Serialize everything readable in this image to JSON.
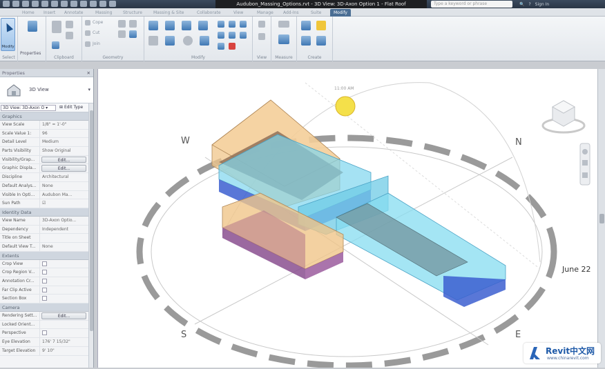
{
  "titlebar": {
    "document_title": "Audubon_Massing_Options.rvt - 3D View: 3D-Axon Option 1 - Flat Roof",
    "search_placeholder": "Type a keyword or phrase",
    "signin": "Sign In",
    "help": "?"
  },
  "tabs": [
    {
      "label": "Home"
    },
    {
      "label": "Insert"
    },
    {
      "label": "Annotate"
    },
    {
      "label": "Massing"
    },
    {
      "label": "Structure"
    },
    {
      "label": "Massing & Site"
    },
    {
      "label": "Collaborate"
    },
    {
      "label": "View"
    },
    {
      "label": "Manage"
    },
    {
      "label": "Add-Ins"
    },
    {
      "label": "Suite"
    },
    {
      "label": "Modify"
    }
  ],
  "ribbon": {
    "select_panel": "Select",
    "modify_button": "Modify",
    "properties_panel": "Properties",
    "clipboard_panel": "Clipboard",
    "geometry_panel": "Geometry",
    "modify_panel": "Modify",
    "view_panel": "View",
    "measure_panel": "Measure",
    "create_panel": "Create",
    "cope_label": "Cope",
    "cut_label": "Cut",
    "join_label": "Join"
  },
  "properties": {
    "header": "Properties",
    "close": "✕",
    "type_name": "3D View",
    "type_filter": "3D View: 3D-Axon O ▾",
    "edit_type": "Edit Type",
    "groups": [
      {
        "name": "Graphics",
        "rows": [
          {
            "key": "View Scale",
            "value": "1/8\" = 1'-0\"",
            "kind": "field"
          },
          {
            "key": "Scale Value    1:",
            "value": "96",
            "kind": "text"
          },
          {
            "key": "Detail Level",
            "value": "Medium",
            "kind": "text"
          },
          {
            "key": "Parts Visibility",
            "value": "Show Original",
            "kind": "text"
          },
          {
            "key": "Visibility/Grap...",
            "value": "Edit...",
            "kind": "button"
          },
          {
            "key": "Graphic Displa...",
            "value": "Edit...",
            "kind": "button"
          },
          {
            "key": "Discipline",
            "value": "Architectural",
            "kind": "text"
          },
          {
            "key": "Default Analys...",
            "value": "None",
            "kind": "text"
          },
          {
            "key": "Visible In Opti...",
            "value": "Audubon Ma...",
            "kind": "text"
          },
          {
            "key": "Sun Path",
            "value": "☑",
            "kind": "check"
          }
        ]
      },
      {
        "name": "Identity Data",
        "rows": [
          {
            "key": "View Name",
            "value": "3D-Axon Optio...",
            "kind": "text"
          },
          {
            "key": "Dependency",
            "value": "Independent",
            "kind": "text"
          },
          {
            "key": "Title on Sheet",
            "value": "",
            "kind": "text"
          },
          {
            "key": "Default View T...",
            "value": "None",
            "kind": "text"
          }
        ]
      },
      {
        "name": "Extents",
        "rows": [
          {
            "key": "Crop View",
            "value": "",
            "kind": "check"
          },
          {
            "key": "Crop Region V...",
            "value": "",
            "kind": "check"
          },
          {
            "key": "Annotation Cr...",
            "value": "",
            "kind": "check"
          },
          {
            "key": "Far Clip Active",
            "value": "",
            "kind": "check"
          },
          {
            "key": "Section Box",
            "value": "",
            "kind": "check"
          }
        ]
      },
      {
        "name": "Camera",
        "rows": [
          {
            "key": "Rendering Sett...",
            "value": "Edit...",
            "kind": "button"
          },
          {
            "key": "Locked Orient...",
            "value": "",
            "kind": "text"
          },
          {
            "key": "Perspective",
            "value": "",
            "kind": "check"
          },
          {
            "key": "Eye Elevation",
            "value": "176' 7 15/32\"",
            "kind": "text"
          },
          {
            "key": "Target Elevation",
            "value": "9' 10\"",
            "kind": "text"
          }
        ]
      }
    ]
  },
  "viewport": {
    "compass_w": "W",
    "compass_n": "N",
    "compass_s": "S",
    "compass_e": "E",
    "date_label": "June 22",
    "sun_time_label": "11:00 AM",
    "colors": {
      "orange_mass": "#f0c58a",
      "purple_mass": "#8a4f8f",
      "cyan_mass": "#7fd6ee",
      "blue_mass": "#3c5fd0",
      "sun": "#f4e04a",
      "sunpath_ring": "#8e8e8e"
    }
  },
  "watermark": {
    "name": "Revit中文网",
    "url": "www.chinarevit.com"
  }
}
